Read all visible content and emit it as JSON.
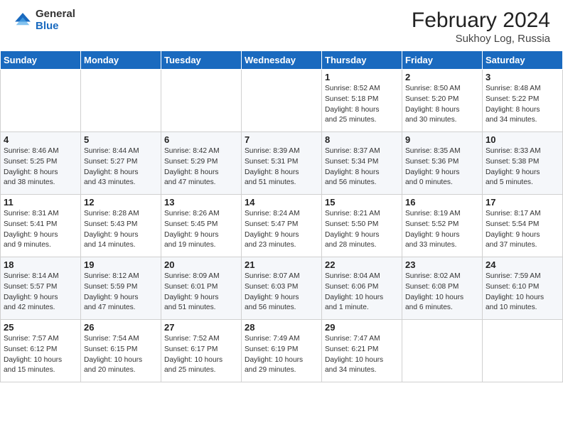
{
  "header": {
    "logo_general": "General",
    "logo_blue": "Blue",
    "title": "February 2024",
    "subtitle": "Sukhoy Log, Russia"
  },
  "weekdays": [
    "Sunday",
    "Monday",
    "Tuesday",
    "Wednesday",
    "Thursday",
    "Friday",
    "Saturday"
  ],
  "weeks": [
    [
      {
        "day": "",
        "info": ""
      },
      {
        "day": "",
        "info": ""
      },
      {
        "day": "",
        "info": ""
      },
      {
        "day": "",
        "info": ""
      },
      {
        "day": "1",
        "info": "Sunrise: 8:52 AM\nSunset: 5:18 PM\nDaylight: 8 hours\nand 25 minutes."
      },
      {
        "day": "2",
        "info": "Sunrise: 8:50 AM\nSunset: 5:20 PM\nDaylight: 8 hours\nand 30 minutes."
      },
      {
        "day": "3",
        "info": "Sunrise: 8:48 AM\nSunset: 5:22 PM\nDaylight: 8 hours\nand 34 minutes."
      }
    ],
    [
      {
        "day": "4",
        "info": "Sunrise: 8:46 AM\nSunset: 5:25 PM\nDaylight: 8 hours\nand 38 minutes."
      },
      {
        "day": "5",
        "info": "Sunrise: 8:44 AM\nSunset: 5:27 PM\nDaylight: 8 hours\nand 43 minutes."
      },
      {
        "day": "6",
        "info": "Sunrise: 8:42 AM\nSunset: 5:29 PM\nDaylight: 8 hours\nand 47 minutes."
      },
      {
        "day": "7",
        "info": "Sunrise: 8:39 AM\nSunset: 5:31 PM\nDaylight: 8 hours\nand 51 minutes."
      },
      {
        "day": "8",
        "info": "Sunrise: 8:37 AM\nSunset: 5:34 PM\nDaylight: 8 hours\nand 56 minutes."
      },
      {
        "day": "9",
        "info": "Sunrise: 8:35 AM\nSunset: 5:36 PM\nDaylight: 9 hours\nand 0 minutes."
      },
      {
        "day": "10",
        "info": "Sunrise: 8:33 AM\nSunset: 5:38 PM\nDaylight: 9 hours\nand 5 minutes."
      }
    ],
    [
      {
        "day": "11",
        "info": "Sunrise: 8:31 AM\nSunset: 5:41 PM\nDaylight: 9 hours\nand 9 minutes."
      },
      {
        "day": "12",
        "info": "Sunrise: 8:28 AM\nSunset: 5:43 PM\nDaylight: 9 hours\nand 14 minutes."
      },
      {
        "day": "13",
        "info": "Sunrise: 8:26 AM\nSunset: 5:45 PM\nDaylight: 9 hours\nand 19 minutes."
      },
      {
        "day": "14",
        "info": "Sunrise: 8:24 AM\nSunset: 5:47 PM\nDaylight: 9 hours\nand 23 minutes."
      },
      {
        "day": "15",
        "info": "Sunrise: 8:21 AM\nSunset: 5:50 PM\nDaylight: 9 hours\nand 28 minutes."
      },
      {
        "day": "16",
        "info": "Sunrise: 8:19 AM\nSunset: 5:52 PM\nDaylight: 9 hours\nand 33 minutes."
      },
      {
        "day": "17",
        "info": "Sunrise: 8:17 AM\nSunset: 5:54 PM\nDaylight: 9 hours\nand 37 minutes."
      }
    ],
    [
      {
        "day": "18",
        "info": "Sunrise: 8:14 AM\nSunset: 5:57 PM\nDaylight: 9 hours\nand 42 minutes."
      },
      {
        "day": "19",
        "info": "Sunrise: 8:12 AM\nSunset: 5:59 PM\nDaylight: 9 hours\nand 47 minutes."
      },
      {
        "day": "20",
        "info": "Sunrise: 8:09 AM\nSunset: 6:01 PM\nDaylight: 9 hours\nand 51 minutes."
      },
      {
        "day": "21",
        "info": "Sunrise: 8:07 AM\nSunset: 6:03 PM\nDaylight: 9 hours\nand 56 minutes."
      },
      {
        "day": "22",
        "info": "Sunrise: 8:04 AM\nSunset: 6:06 PM\nDaylight: 10 hours\nand 1 minute."
      },
      {
        "day": "23",
        "info": "Sunrise: 8:02 AM\nSunset: 6:08 PM\nDaylight: 10 hours\nand 6 minutes."
      },
      {
        "day": "24",
        "info": "Sunrise: 7:59 AM\nSunset: 6:10 PM\nDaylight: 10 hours\nand 10 minutes."
      }
    ],
    [
      {
        "day": "25",
        "info": "Sunrise: 7:57 AM\nSunset: 6:12 PM\nDaylight: 10 hours\nand 15 minutes."
      },
      {
        "day": "26",
        "info": "Sunrise: 7:54 AM\nSunset: 6:15 PM\nDaylight: 10 hours\nand 20 minutes."
      },
      {
        "day": "27",
        "info": "Sunrise: 7:52 AM\nSunset: 6:17 PM\nDaylight: 10 hours\nand 25 minutes."
      },
      {
        "day": "28",
        "info": "Sunrise: 7:49 AM\nSunset: 6:19 PM\nDaylight: 10 hours\nand 29 minutes."
      },
      {
        "day": "29",
        "info": "Sunrise: 7:47 AM\nSunset: 6:21 PM\nDaylight: 10 hours\nand 34 minutes."
      },
      {
        "day": "",
        "info": ""
      },
      {
        "day": "",
        "info": ""
      }
    ]
  ]
}
